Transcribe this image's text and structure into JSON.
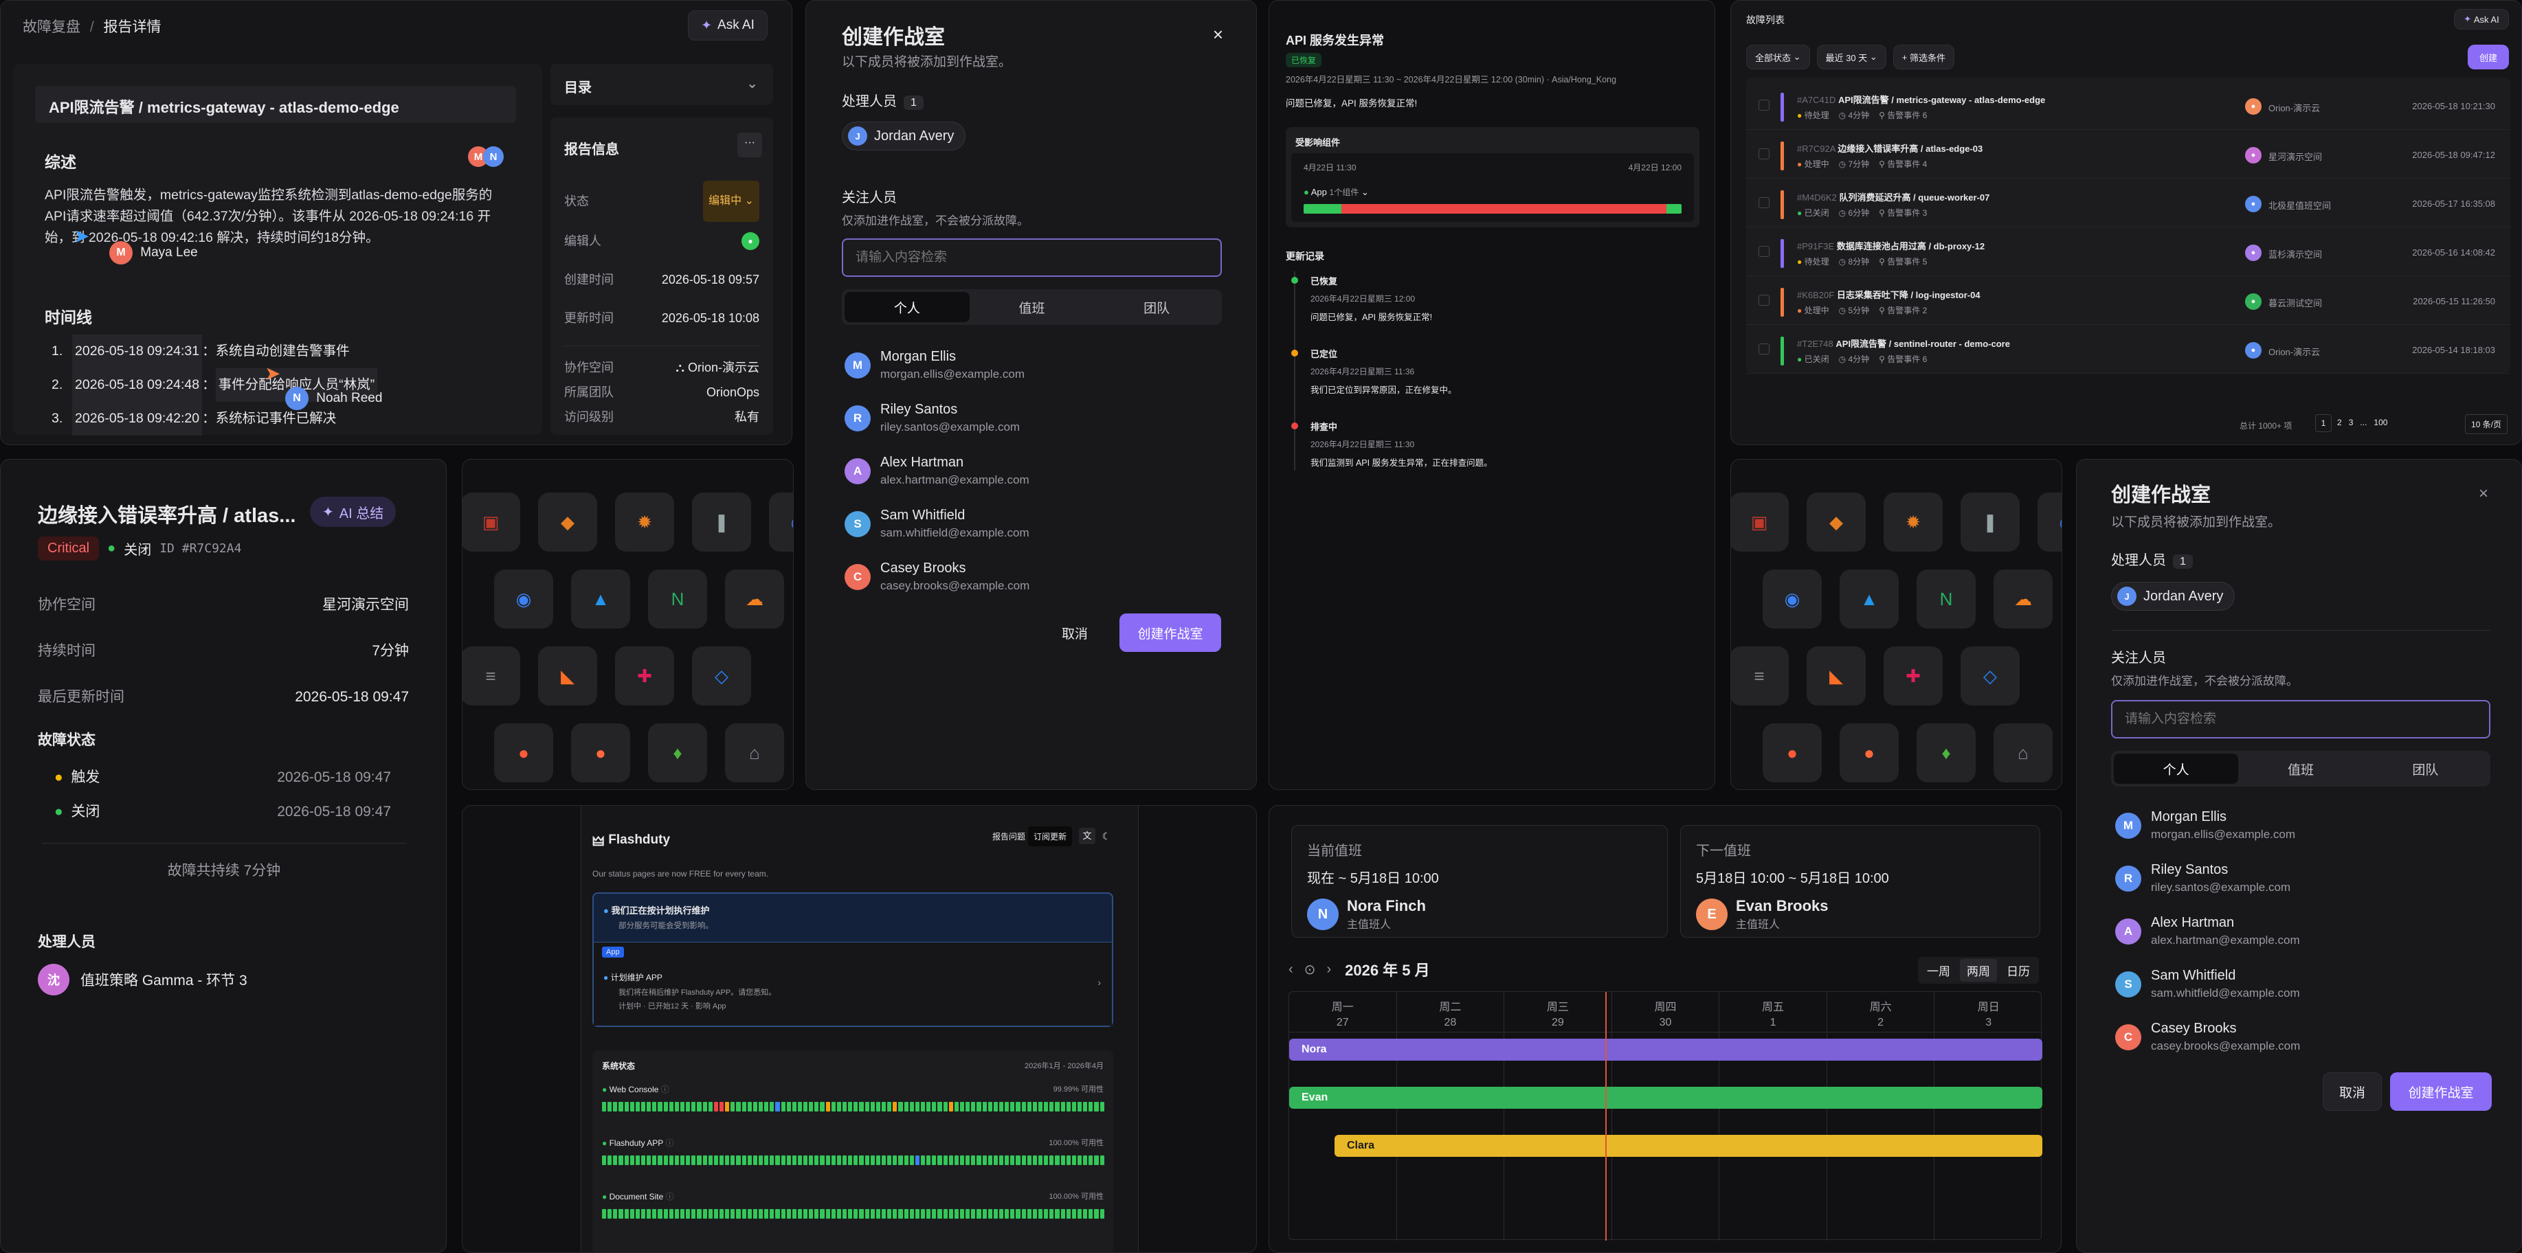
{
  "t1": {
    "crumb_parent": "故障复盘",
    "crumb_sep": "/",
    "crumb_current": "报告详情",
    "ask_ai": "Ask AI",
    "title": "API限流告警 / metrics-gateway - atlas-demo-edge",
    "summary_h": "综述",
    "summary_text": "API限流告警触发，metrics-gateway监控系统检测到atlas-demo-edge服务的API请求速率超过阈值（642.37次/分钟）。该事件从 2026-05-18 09:24:16 开始，到 2026-05-18 09:42:16 解决，持续时间约18分钟。",
    "cursor1": "Maya Lee",
    "cursor2": "Noah Reed",
    "timeline_h": "时间线",
    "timeline": [
      {
        "n": "1.",
        "t": "2026-05-18 09:24:31",
        "s": "系统自动创建告警事件"
      },
      {
        "n": "2.",
        "t": "2026-05-18 09:24:48",
        "s": "事件分配给响应人员“林岚”"
      },
      {
        "n": "3.",
        "t": "2026-05-18 09:42:20",
        "s": "系统标记事件已解决"
      }
    ],
    "toc": "目录",
    "info_h": "报告信息",
    "info": [
      {
        "k": "状态",
        "v": "编辑中"
      },
      {
        "k": "编辑人",
        "v": ""
      },
      {
        "k": "创建时间",
        "v": "2026-05-18 09:57"
      },
      {
        "k": "更新时间",
        "v": "2026-05-18 10:08"
      }
    ],
    "info2": [
      {
        "k": "协作空间",
        "v": "Orion-演示云"
      },
      {
        "k": "所属团队",
        "v": "OrionOps"
      },
      {
        "k": "访问级别",
        "v": "私有"
      }
    ]
  },
  "dialog": {
    "title": "创建作战室",
    "subtitle": "以下成员将被添加到作战室。",
    "handler_label": "处理人员",
    "handler_count": "1",
    "handler": "Jordan Avery",
    "follow_label": "关注人员",
    "follow_hint": "仅添加进作战室，不会被分派故障。",
    "search_ph": "请输入内容检索",
    "tabs": [
      "个人",
      "值班",
      "团队"
    ],
    "people": [
      {
        "n": "Morgan Ellis",
        "e": "morgan.ellis@example.com",
        "i": "M",
        "c": "#5b8def"
      },
      {
        "n": "Riley Santos",
        "e": "riley.santos@example.com",
        "i": "R",
        "c": "#5b8def"
      },
      {
        "n": "Alex Hartman",
        "e": "alex.hartman@example.com",
        "i": "A",
        "c": "#a77be8"
      },
      {
        "n": "Sam Whitfield",
        "e": "sam.whitfield@example.com",
        "i": "S",
        "c": "#4fa3e0"
      },
      {
        "n": "Casey Brooks",
        "e": "casey.brooks@example.com",
        "i": "C",
        "c": "#ef6d5b"
      }
    ],
    "cancel": "取消",
    "create": "创建作战室"
  },
  "t3": {
    "title": "API 服务发生异常",
    "badge": "已恢复",
    "time": "2026年4月22日星期三 11:30 ~ 2026年4月22日星期三 12:00 (30min) · Asia/Hong_Kong",
    "summary": "问题已修复，API 服务恢复正常!",
    "comp_h": "受影响组件",
    "d1": "4月22日 11:30",
    "d2": "4月22日 12:00",
    "app": "App",
    "app_sub": "1个组件",
    "upd_h": "更新记录",
    "updates": [
      {
        "s": "已恢复",
        "t": "2026年4月22日星期三 12:00",
        "d": "问题已修复，API 服务恢复正常!",
        "c": "#34c759"
      },
      {
        "s": "已定位",
        "t": "2026年4月22日星期三 11:36",
        "d": "我们已定位到异常原因，正在修复中。",
        "c": "#f59e0b"
      },
      {
        "s": "排查中",
        "t": "2026年4月22日星期三 11:30",
        "d": "我们监测到 API 服务发生异常，正在排查问题。",
        "c": "#ef4444"
      }
    ]
  },
  "t4": {
    "crumb": "故障列表",
    "ask_ai": "Ask AI",
    "f1": "全部状态",
    "f2": "最近 30 天",
    "f3": "筛选条件",
    "create": "创建",
    "rows": [
      {
        "id": "#A7C41D",
        "t": "API限流告警 / metrics-gateway - atlas-demo-edge",
        "st": "待处理",
        "d": "4分钟",
        "ev": "告警事件 6",
        "sp": "Orion-演示云",
        "tm": "2026-05-18 10:21:30",
        "c": "#8b6cf6",
        "sc": "#f5b800"
      },
      {
        "id": "#R7C92A",
        "t": "边缘接入错误率升高 / atlas-edge-03",
        "st": "处理中",
        "d": "7分钟",
        "ev": "告警事件 4",
        "sp": "星河演示空间",
        "tm": "2026-05-18 09:47:12",
        "c": "#f07b3f",
        "sc": "#f07b3f"
      },
      {
        "id": "#M4D6K2",
        "t": "队列消费延迟升高 / queue-worker-07",
        "st": "已关闭",
        "d": "6分钟",
        "ev": "告警事件 3",
        "sp": "北极星值班空间",
        "tm": "2026-05-17 16:35:08",
        "c": "#f07b3f",
        "sc": "#34c759"
      },
      {
        "id": "#P91F3E",
        "t": "数据库连接池占用过高 / db-proxy-12",
        "st": "待处理",
        "d": "8分钟",
        "ev": "告警事件 5",
        "sp": "蓝杉演示空间",
        "tm": "2026-05-16 14:08:42",
        "c": "#8b6cf6",
        "sc": "#f5b800"
      },
      {
        "id": "#K6B20F",
        "t": "日志采集吞吐下降 / log-ingestor-04",
        "st": "处理中",
        "d": "5分钟",
        "ev": "告警事件 2",
        "sp": "暮云测试空间",
        "tm": "2026-05-15 11:26:50",
        "c": "#f07b3f",
        "sc": "#f07b3f"
      },
      {
        "id": "#T2E748",
        "t": "API限流告警 / sentinel-router - demo-core",
        "st": "已关闭",
        "d": "4分钟",
        "ev": "告警事件 6",
        "sp": "Orion-演示云",
        "tm": "2026-05-14 18:18:03",
        "c": "#34c759",
        "sc": "#34c759"
      }
    ],
    "total": "总计 1000+ 项",
    "pages": [
      "1",
      "2",
      "3",
      "...",
      "100"
    ],
    "psize": "10 条/页"
  },
  "t5": {
    "title": "边缘接入错误率升高 / atlas...",
    "ai": "AI 总结",
    "sev": "Critical",
    "closed": "关闭",
    "id": "ID #R7C92A4",
    "rows": [
      {
        "k": "协作空间",
        "v": "星河演示空间"
      },
      {
        "k": "持续时间",
        "v": "7分钟"
      },
      {
        "k": "最后更新时间",
        "v": "2026-05-18 09:47"
      }
    ],
    "state_h": "故障状态",
    "states": [
      {
        "s": "触发",
        "t": "2026-05-18 09:47"
      },
      {
        "s": "关闭",
        "t": "2026-05-18 09:47"
      }
    ],
    "lasted": "故障共持续 7分钟",
    "handler_h": "处理人员",
    "handler": "值班策略 Gamma - 环节 3",
    "handler_av": "沈"
  },
  "t9": {
    "brand": "Flashduty",
    "nav1": "报告问题",
    "nav2": "订阅更新",
    "free": "Our status pages are now FREE for every team.",
    "maint_title": "我们正在按计划执行维护",
    "maint_sub": "部分服务可能会受到影响。",
    "app": "App",
    "plan_title": "计划维护 APP",
    "plan_d1": "我们将在稍后维护 Flashduty APP。请您悉知。",
    "plan_d2": "计划中 · 已开始12 天 · 影响 App",
    "sys_h": "系统状态",
    "sys_range": "2026年1月 - 2026年4月",
    "services": [
      {
        "n": "Web Console",
        "p": "99.99% 可用性"
      },
      {
        "n": "Flashduty APP",
        "p": "100.00% 可用性"
      },
      {
        "n": "Document Site",
        "p": "100.00% 可用性"
      }
    ]
  },
  "t10": {
    "cur_h": "当前值班",
    "cur_time": "现在 ~ 5月18日 10:00",
    "cur_name": "Nora Finch",
    "cur_role": "主值班人",
    "next_h": "下一值班",
    "next_time": "5月18日 10:00 ~ 5月18日 10:00",
    "next_name": "Evan Brooks",
    "next_role": "主值班人",
    "month": "2026 年 5 月",
    "views": [
      "一周",
      "两周",
      "日历"
    ],
    "days": [
      {
        "w": "周一",
        "d": "27"
      },
      {
        "w": "周二",
        "d": "28"
      },
      {
        "w": "周三",
        "d": "29"
      },
      {
        "w": "周四",
        "d": "30"
      },
      {
        "w": "周五",
        "d": "1"
      },
      {
        "w": "周六",
        "d": "2"
      },
      {
        "w": "周日",
        "d": "3"
      }
    ],
    "bars": [
      {
        "n": "Nora",
        "c": "#7c62d6"
      },
      {
        "n": "Evan",
        "c": "#34b45a"
      },
      {
        "n": "Clara",
        "c": "#e8b828"
      }
    ]
  },
  "logos": [
    "Oracle",
    "Grafana",
    "Firebase",
    "Docker",
    "Nginx",
    "Cloudflare",
    "Datadog",
    "GitLab",
    "Slack",
    "Jira",
    "MongoDB"
  ],
  "colors": {
    "accent": "#8b6cf6",
    "danger": "#ef4444",
    "success": "#34c759",
    "warning": "#f5b800"
  }
}
